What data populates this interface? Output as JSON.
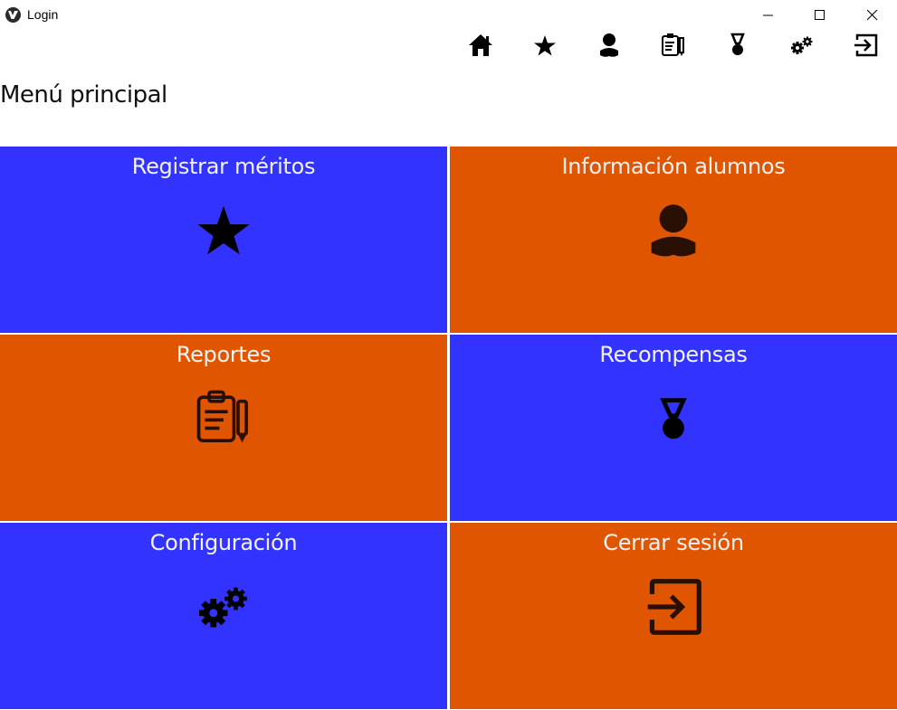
{
  "window": {
    "title": "Login"
  },
  "toolbar": {
    "items": [
      {
        "icon": "home-icon"
      },
      {
        "icon": "star-icon"
      },
      {
        "icon": "user-icon"
      },
      {
        "icon": "report-icon"
      },
      {
        "icon": "medal-icon"
      },
      {
        "icon": "gears-icon"
      },
      {
        "icon": "logout-icon"
      }
    ]
  },
  "page": {
    "title": "Menú principal"
  },
  "colors": {
    "blue": "#3333ff",
    "orange": "#e05500",
    "icon_on_orange": "#2a0f05",
    "icon_on_blue": "#000000"
  },
  "tiles": [
    {
      "label": "Registrar méritos",
      "icon": "star-icon",
      "color": "#3333ff"
    },
    {
      "label": "Información alumnos",
      "icon": "user-icon",
      "color": "#e05500"
    },
    {
      "label": "Reportes",
      "icon": "report-icon",
      "color": "#e05500"
    },
    {
      "label": "Recompensas",
      "icon": "medal-icon",
      "color": "#3333ff"
    },
    {
      "label": "Configuración",
      "icon": "gears-icon",
      "color": "#3333ff"
    },
    {
      "label": "Cerrar sesión",
      "icon": "logout-icon",
      "color": "#e05500"
    }
  ]
}
